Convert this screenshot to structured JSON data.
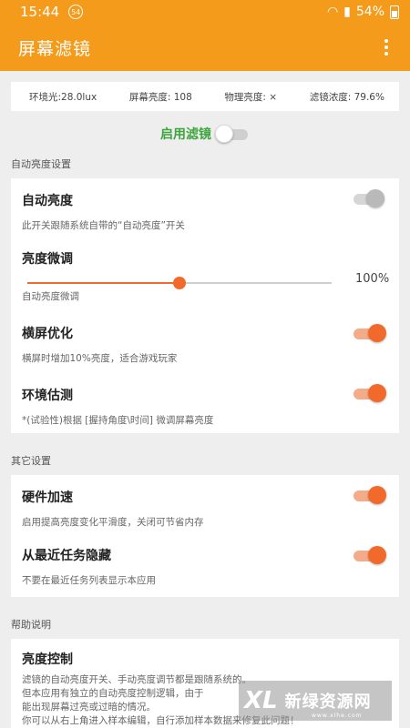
{
  "status_bar": {
    "time": "15:44",
    "badge": "54",
    "battery_pct": "54%"
  },
  "app_bar": {
    "title": "屏幕滤镜"
  },
  "info": {
    "ambient": "环境光:28.0lux",
    "screen_brightness": "屏幕亮度: 108",
    "physical_brightness": "物理亮度: ×",
    "filter_density": "滤镜浓度: 79.6%"
  },
  "master_switch": {
    "label": "启用滤镜",
    "on": false
  },
  "sections": {
    "auto": {
      "title": "自动亮度设置",
      "auto_brightness": {
        "label": "自动亮度",
        "desc": "此开关跟随系统自带的“自动亮度”开关",
        "on": true
      },
      "fine_tune": {
        "label": "亮度微调",
        "desc": "自动亮度微调",
        "value_pct": 50,
        "value_label": "100%"
      },
      "landscape": {
        "label": "横屏优化",
        "desc": "横屏时增加10%亮度，适合游戏玩家",
        "on": true
      },
      "env_estimate": {
        "label": "环境估测",
        "desc": "*(试验性)根据 [握持角度\\时间] 微调屏幕亮度",
        "on": true
      }
    },
    "other": {
      "title": "其它设置",
      "hw_accel": {
        "label": "硬件加速",
        "desc": "启用提高亮度变化平滑度，关闭可节省内存",
        "on": true
      },
      "hide_recent": {
        "label": "从最近任务隐藏",
        "desc": "不要在最近任务列表显示本应用",
        "on": true
      }
    },
    "help": {
      "title": "帮助说明",
      "brightness_control": {
        "label": "亮度控制",
        "lines": [
          "滤镜的自动亮度开关、手动亮度调节都是跟随系统的。",
          "但本应用有独立的自动亮度控制逻辑，由于",
          "能出现屏幕过亮或过暗的情况。",
          "你可以从右上角进入样本编辑，自行添加样本数据来修复此问题！"
        ]
      }
    }
  },
  "watermark": {
    "logo": "XL",
    "text": "新绿资源网",
    "url": "www.xlhe.com"
  }
}
